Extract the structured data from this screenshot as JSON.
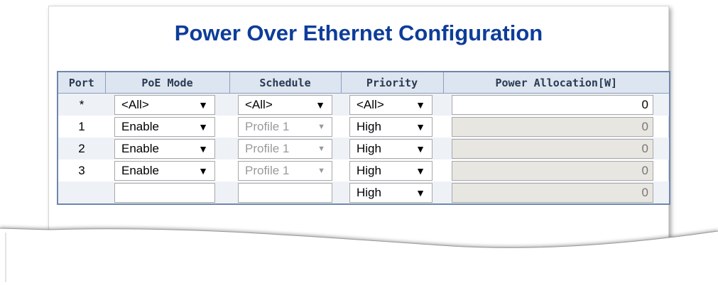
{
  "title": "Power Over Ethernet Configuration",
  "columns": {
    "port": "Port",
    "mode": "PoE Mode",
    "schedule": "Schedule",
    "priority": "Priority",
    "power": "Power Allocation[W]"
  },
  "rows": [
    {
      "port": "*",
      "mode": "<All>",
      "schedule": "<All>",
      "priority": "<All>",
      "power": "0"
    },
    {
      "port": "1",
      "mode": "Enable",
      "schedule": "Profile 1",
      "priority": "High",
      "power": "0"
    },
    {
      "port": "2",
      "mode": "Enable",
      "schedule": "Profile 1",
      "priority": "High",
      "power": "0"
    },
    {
      "port": "3",
      "mode": "Enable",
      "schedule": "Profile 1",
      "priority": "High",
      "power": "0"
    },
    {
      "port": "",
      "mode": "",
      "schedule": "",
      "priority": "High",
      "power": "0"
    }
  ],
  "arrow": "▼",
  "colors": {
    "title": "#0d3d9a",
    "header_bg": "#dde5f0",
    "alt_row_bg": "#eef1f6",
    "table_border": "#6d87ad",
    "disabled_text": "#9a9a9a",
    "disabled_field_bg": "#e8e6e0"
  }
}
